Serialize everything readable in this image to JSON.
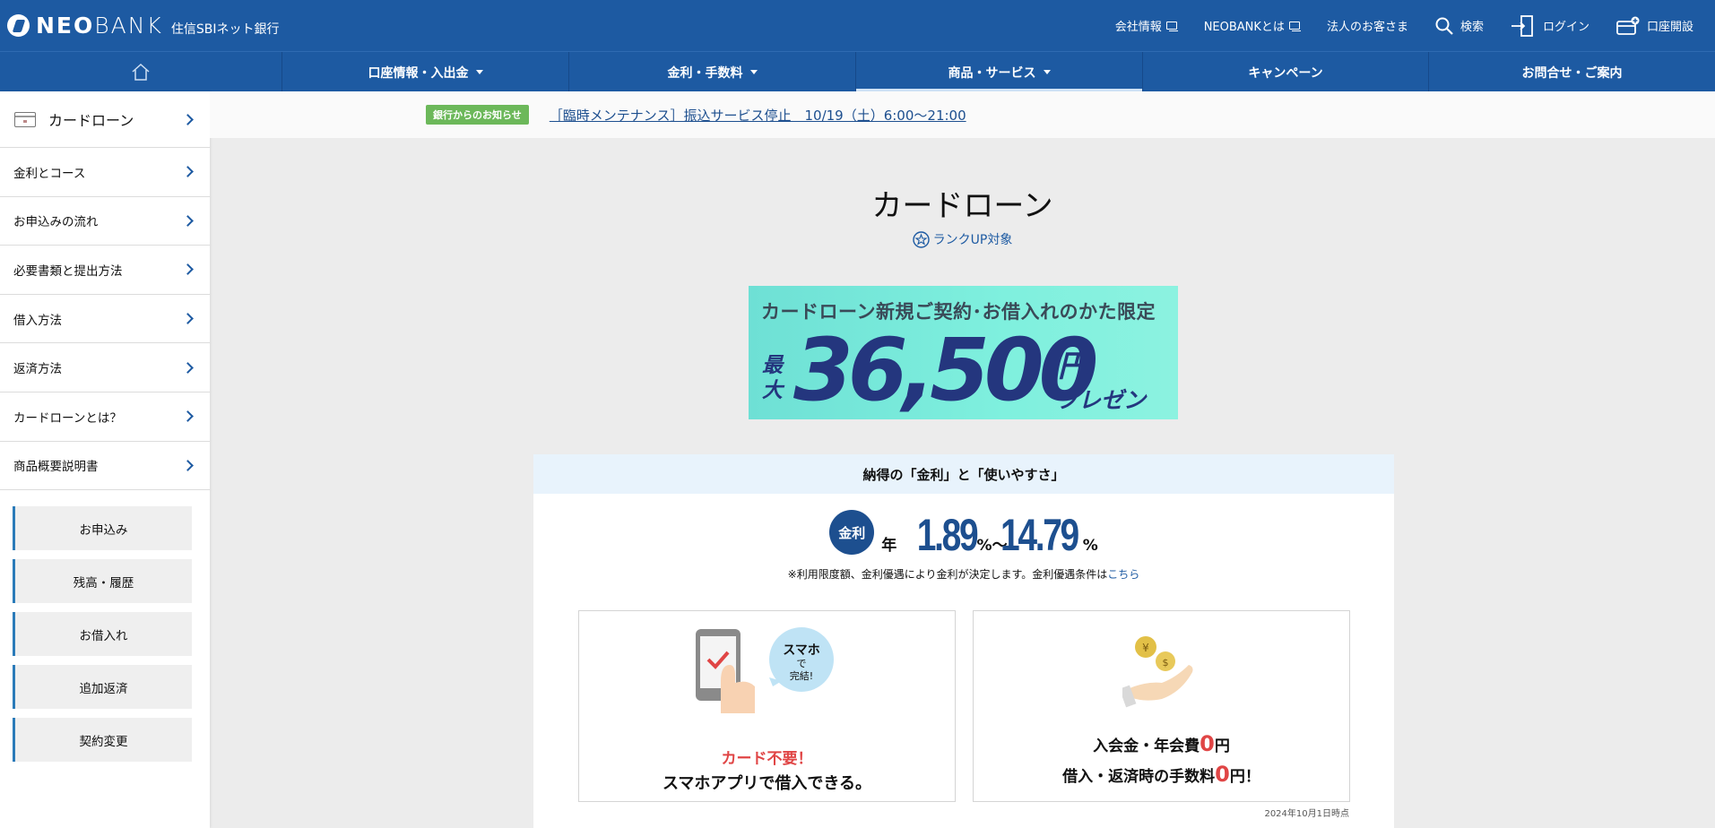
{
  "header": {
    "logo_text_bold": "NEO",
    "logo_text_light": "BANK",
    "logo_sub": "住信SBIネット銀行",
    "links": [
      {
        "label": "会社情報",
        "icon": "external-link-icon"
      },
      {
        "label": "NEOBANKとは",
        "icon": "external-link-icon"
      },
      {
        "label": "法人のお客さま",
        "icon": ""
      },
      {
        "label": "検索",
        "icon": "search-icon"
      },
      {
        "label": "ログイン",
        "icon": "login-icon"
      },
      {
        "label": "口座開設",
        "icon": "account-open-icon"
      }
    ]
  },
  "nav": {
    "home_icon": "home-icon",
    "items": [
      {
        "label": "口座情報・入出金",
        "dropdown": true
      },
      {
        "label": "金利・手数料",
        "dropdown": true
      },
      {
        "label": "商品・サービス",
        "dropdown": true,
        "active": true
      },
      {
        "label": "キャンペーン",
        "dropdown": false
      },
      {
        "label": "お問合せ・ご案内",
        "dropdown": false
      }
    ]
  },
  "sidebar": {
    "title": "カードローン",
    "items": [
      "金利とコース",
      "お申込みの流れ",
      "必要書類と提出方法",
      "借入方法",
      "返済方法",
      "カードローンとは？",
      "商品概要説明書"
    ],
    "buttons": [
      "お申込み",
      "残高・履歴",
      "お借入れ",
      "追加返済",
      "契約変更"
    ]
  },
  "notice": {
    "badge": "銀行からのお知らせ",
    "link": "［臨時メンテナンス］振込サービス停止　10/19（土）6:00〜21:00"
  },
  "main": {
    "title": "カードローン",
    "rank_label": "ランクUP対象",
    "banner": {
      "line1": "カードローン新規ご契約･お借入れのかた限定",
      "max": "最大",
      "amount": "36,500",
      "yen": "円",
      "present": "プレゼント!"
    },
    "panel": {
      "heading": "納得の「金利」と「使いやすさ」",
      "rate_badge": "金利",
      "rate_year": "年",
      "rate_min": "1.89",
      "rate_pct1": "%〜",
      "rate_max": "14.79",
      "rate_pct2": "%",
      "note": "※利用限度額、金利優遇により金利が決定します。金利優遇条件は",
      "note_link": "こちら",
      "feature_left": {
        "bubble_line1": "スマホ",
        "bubble_line2": "で",
        "bubble_line3": "完結!",
        "red": "カード不要！",
        "black": "スマホアプリで借入できる。"
      },
      "feature_right": {
        "r1a": "入会金・年会費",
        "r1zero": "0",
        "r1b": "円",
        "r2a": "借入・返済時の手数料",
        "r2zero": "0",
        "r2b": "円！"
      },
      "as_of": "2024年10月1日時点"
    }
  },
  "colors": {
    "header_blue": "#1d5aa2",
    "accent_red": "#e04545",
    "badge_green": "#6cb85a",
    "banner_mint": "#7ff0de"
  }
}
